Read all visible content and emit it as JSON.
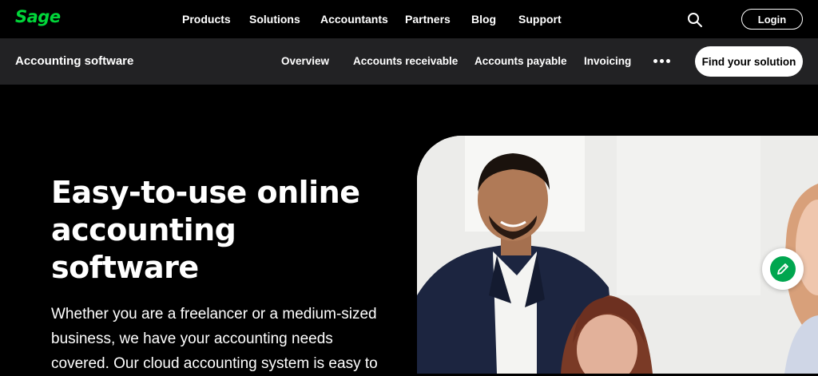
{
  "brand": {
    "logo_text": "Sage",
    "accent": "#00d639"
  },
  "top_nav": {
    "links": [
      "Products",
      "Solutions",
      "Accountants",
      "Partners",
      "Blog",
      "Support"
    ],
    "search_icon": "search-icon",
    "login_label": "Login"
  },
  "sub_nav": {
    "title": "Accounting software",
    "items": [
      "Overview",
      "Accounts receivable",
      "Accounts payable",
      "Invoicing"
    ],
    "more_icon": "more-dots-icon",
    "cta_label": "Find your solution"
  },
  "hero": {
    "title": "Easy-to-use online accounting software",
    "text": "Whether you are a freelancer or a medium-sized business, we have your accounting needs covered. Our cloud accounting system is easy to"
  },
  "feedback": {
    "icon": "pencil-icon",
    "color": "#00a64f"
  }
}
